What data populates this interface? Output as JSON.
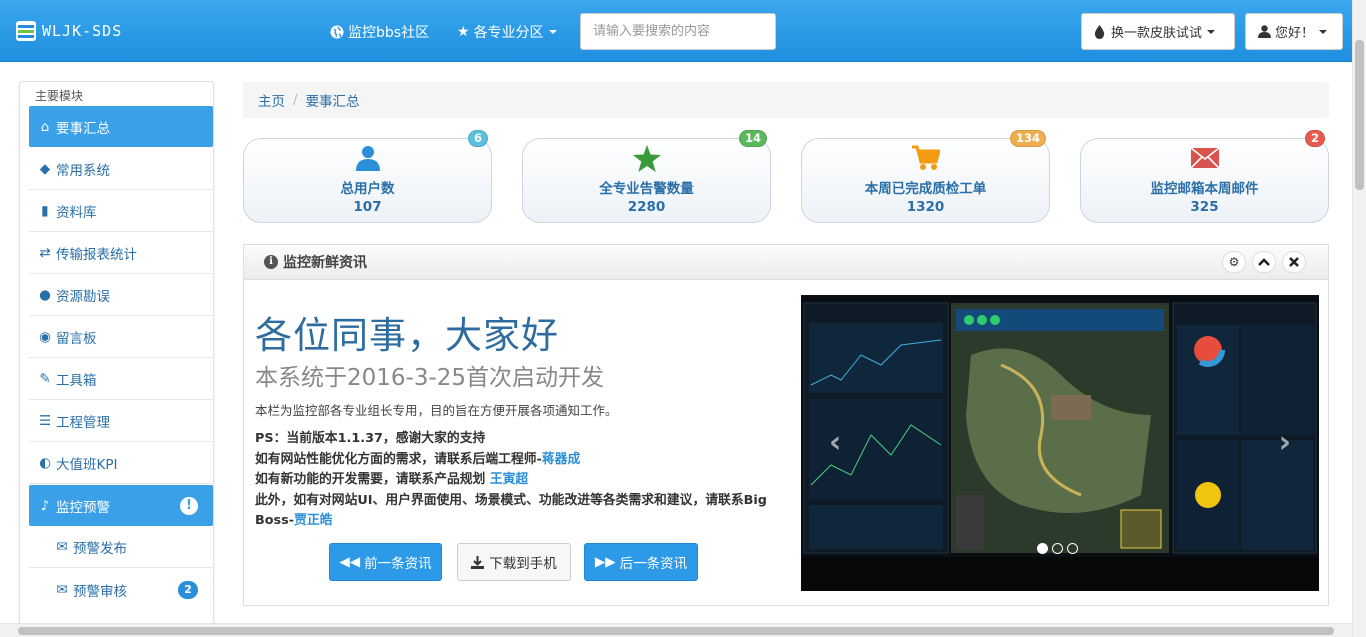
{
  "navbar": {
    "brand": "WLJK-SDS",
    "links": [
      {
        "label": "监控bbs社区",
        "icon": "globe-icon"
      },
      {
        "label": "各专业分区",
        "icon": "star-icon"
      }
    ],
    "search_placeholder": "请输入要搜索的内容",
    "skin_button": "换一款皮肤试试",
    "user_button": "您好！"
  },
  "sidebar": {
    "header": "主要模块",
    "items": [
      {
        "label": "要事汇总",
        "icon": "home-icon",
        "active": true
      },
      {
        "label": "常用系统",
        "icon": "tags-icon"
      },
      {
        "label": "资料库",
        "icon": "book-icon"
      },
      {
        "label": "传输报表统计",
        "icon": "retweet-icon"
      },
      {
        "label": "资源勘误",
        "icon": "exclamation-icon"
      },
      {
        "label": "留言板",
        "icon": "eye-icon"
      },
      {
        "label": "工具箱",
        "icon": "edit-icon"
      },
      {
        "label": "工程管理",
        "icon": "list-icon"
      },
      {
        "label": "大值班KPI",
        "icon": "adjust-icon"
      },
      {
        "label": "监控预警",
        "icon": "bell-icon",
        "active": true,
        "alert": "!"
      },
      {
        "label": "预警发布",
        "icon": "envelope-icon",
        "sub": true
      },
      {
        "label": "预警审核",
        "icon": "envelope-icon",
        "sub": true,
        "badge": "2"
      }
    ]
  },
  "breadcrumb": {
    "home": "主页",
    "current": "要事汇总"
  },
  "stats": [
    {
      "label": "总用户数",
      "value": "107",
      "badge": "6",
      "badge_color": "#5bc0de",
      "icon": "user-icon",
      "icon_color": "#2a8fd8"
    },
    {
      "label": "全专业告警数量",
      "value": "2280",
      "badge": "14",
      "badge_color": "#5cb85c",
      "icon": "star-icon",
      "icon_color": "#3a9a3a"
    },
    {
      "label": "本周已完成质检工单",
      "value": "1320",
      "badge": "134",
      "badge_color": "#f0ad4e",
      "icon": "cart-icon",
      "icon_color": "#f39c12"
    },
    {
      "label": "监控邮箱本周邮件",
      "value": "325",
      "badge": "2",
      "badge_color": "#e65c4f",
      "icon": "envelope-icon",
      "icon_color": "#d9534f"
    }
  ],
  "panel": {
    "title": "监控新鲜资讯",
    "hero_title": "各位同事，大家好",
    "hero_subtitle": "本系统于2016-3-25首次启动开发",
    "description": "本栏为监控部各专业组长专用，目的旨在方便开展各项通知工作。",
    "ps_line1": "PS：当前版本1.1.37，感谢大家的支持",
    "ps_line2_pre": "如有网站性能优化方面的需求，请联系后端工程师-",
    "ps_line2_name": "蒋器成",
    "ps_line3_pre": "如有新功能的开发需要，请联系产品规划",
    "ps_line3_name": "王寅超",
    "ps_line4_pre": "此外，如有对网站UI、用户界面使用、场景模式、功能改进等各类需求和建议，请联系Big Boss-",
    "ps_line4_name": "贾正皓",
    "btn_prev": "前一条资讯",
    "btn_download": "下载到手机",
    "btn_next": "后一条资讯"
  },
  "colors": {
    "primary": "#2d9ae8",
    "link": "#2a6fa8"
  }
}
